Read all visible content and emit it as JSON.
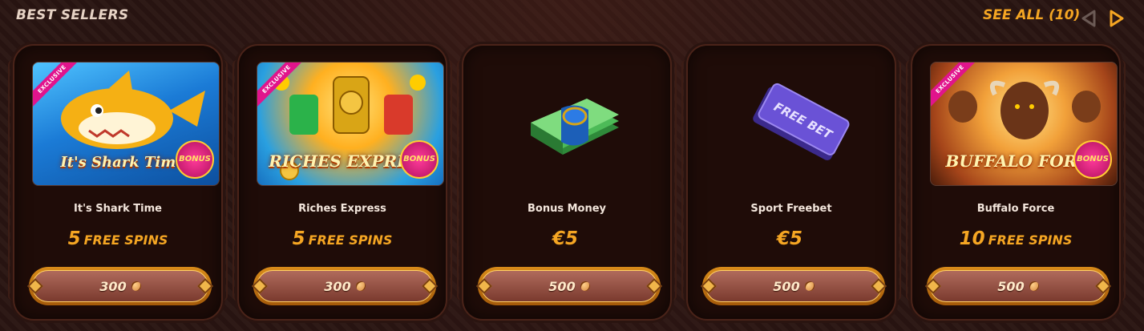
{
  "header": {
    "title": "BEST SELLERS",
    "see_all": "SEE ALL (10)",
    "prev_icon": "prev-arrow-icon",
    "next_icon": "next-arrow-icon",
    "accent": "#f5a623"
  },
  "cards": [
    {
      "name": "It's Shark Time",
      "reward_number": "5",
      "reward_label": "FREE SPINS",
      "price": "300",
      "badge": "EXCLUSIVE",
      "logo": "It's Shark Time!",
      "bonus": "BONUS",
      "image": "shark-time-game-thumbnail"
    },
    {
      "name": "Riches Express",
      "reward_number": "5",
      "reward_label": "FREE SPINS",
      "price": "300",
      "badge": "EXCLUSIVE",
      "logo": "RICHES EXPRESS",
      "bonus": "BONUS",
      "image": "riches-express-game-thumbnail"
    },
    {
      "name": "Bonus Money",
      "reward_number": "€5",
      "reward_label": "",
      "price": "500",
      "image": "money-stack-icon"
    },
    {
      "name": "Sport Freebet",
      "reward_number": "€5",
      "reward_label": "",
      "price": "500",
      "ticket_text": "FREE BET",
      "image": "free-bet-ticket-icon"
    },
    {
      "name": "Buffalo Force",
      "reward_number": "10",
      "reward_label": "FREE SPINS",
      "price": "500",
      "badge": "EXCLUSIVE",
      "logo": "BUFFALO FORCE",
      "bonus": "BONUS",
      "image": "buffalo-force-game-thumbnail"
    }
  ],
  "currency_icon": "coin-icon"
}
